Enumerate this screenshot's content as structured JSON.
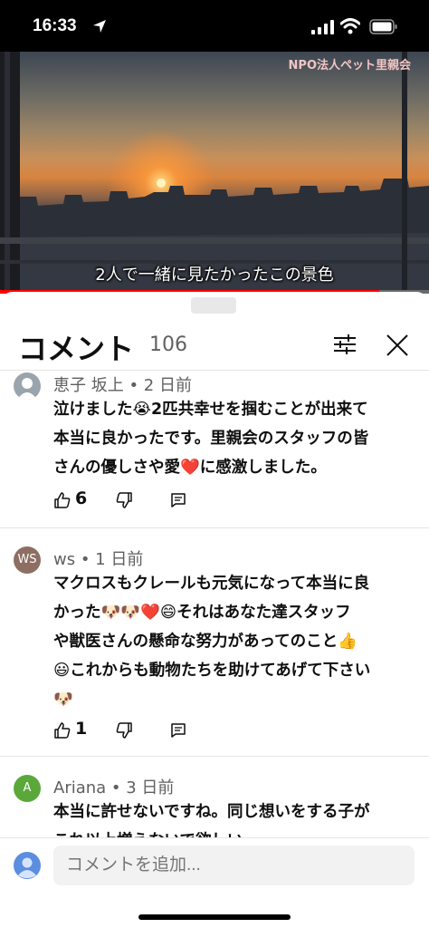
{
  "status_bar": {
    "time": "16:33"
  },
  "video": {
    "watermark": "NPO法人ペット里親会",
    "subtitle": "2人で一緒に見たかったこの景色",
    "progress": 0.885
  },
  "sheet": {
    "title": "コメント",
    "count": "106",
    "comments": [
      {
        "meta": "恵子 坂上 • 2 日前",
        "lines": [
          "泣けました😭2匹共幸せを掴むことが出来て",
          "本当に良かったです。里親会のスタッフの皆",
          "さんの優しさや愛❤️に感激しました。"
        ],
        "likes": "6"
      },
      {
        "avatar_text": "WS",
        "meta": "ws • 1 日前",
        "lines": [
          "マクロスもクレールも元気になって本当に良",
          "かった🐶🐶❤️😄それはあなた達スタッフ",
          "や獣医さんの懸命な努力があってのこと👍",
          "😃これからも動物たちを助けてあげて下さい",
          "🐶"
        ],
        "likes": "1"
      },
      {
        "avatar_text": "A",
        "meta": "Ariana • 3 日前",
        "lines": [
          "本当に許せないですね。同じ想いをする子が",
          "これ以上増えないで欲しい"
        ]
      }
    ]
  },
  "add_comment": {
    "placeholder": "コメントを追加..."
  },
  "colors": {
    "progress": "#ff0000",
    "avatar_ws": "#8d6e63",
    "avatar_a": "#5aa83a",
    "avatar_default": "#9aa4ad"
  }
}
